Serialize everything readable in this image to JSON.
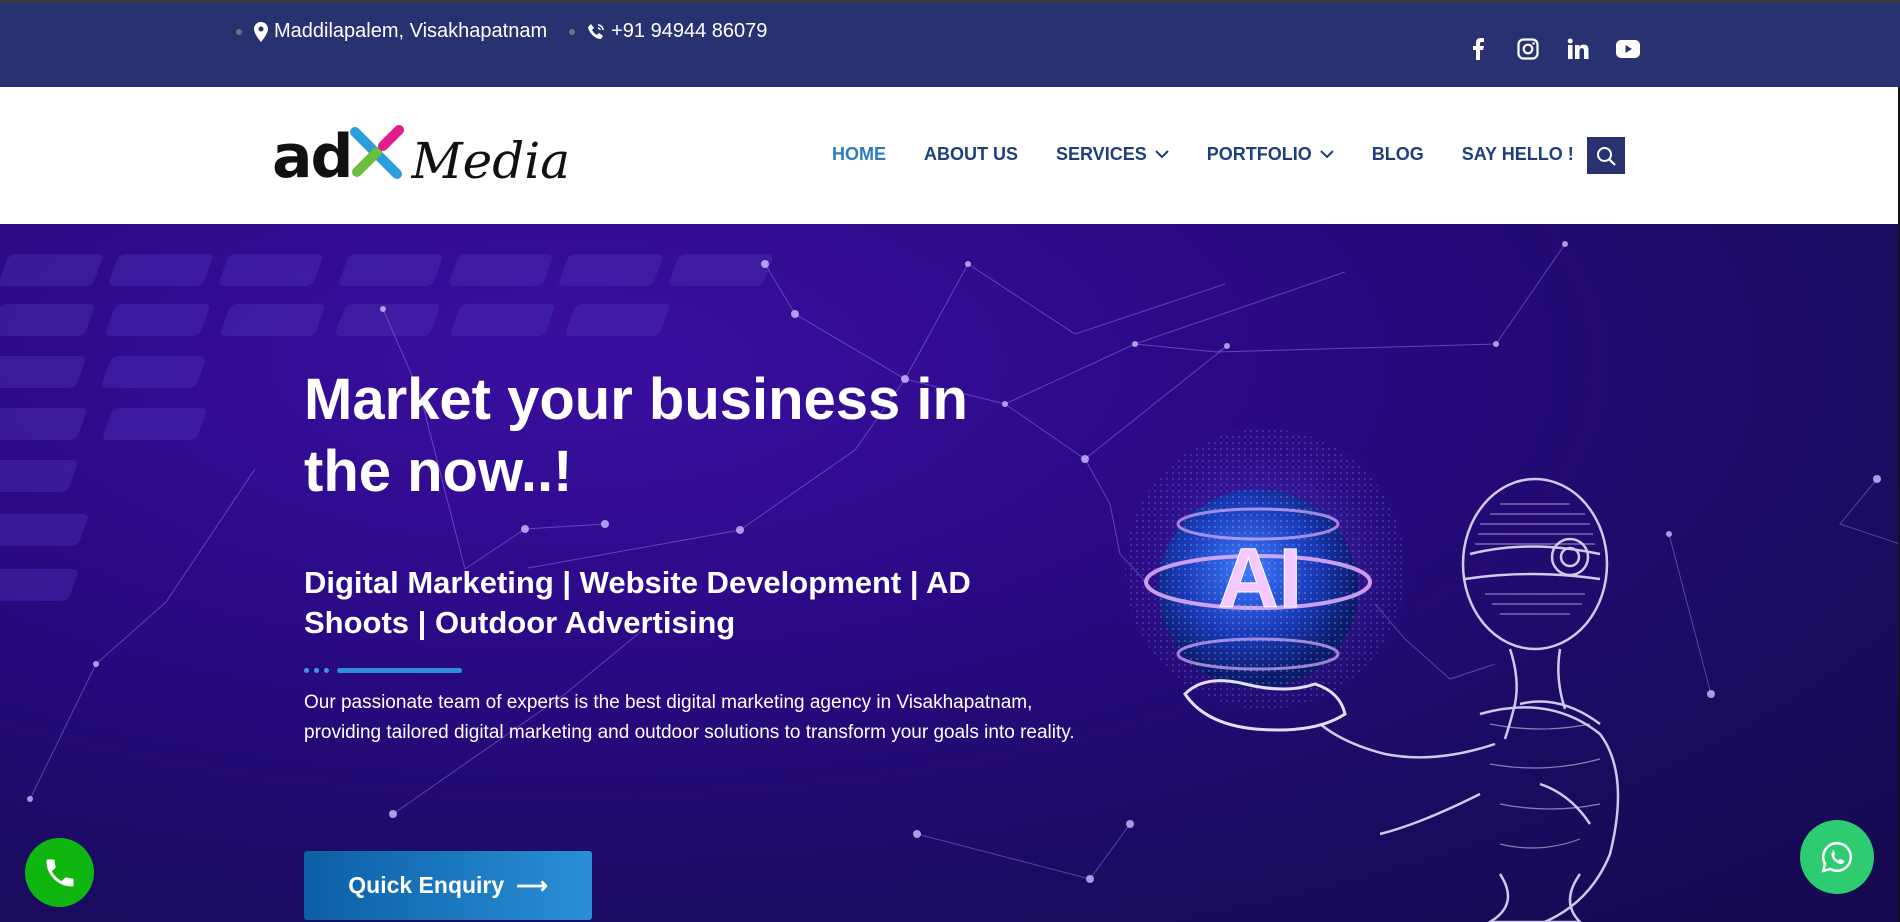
{
  "topbar": {
    "location": "Maddilapalem, Visakhapatnam",
    "phone": "+91 94944 86079",
    "socials": [
      "facebook-icon",
      "instagram-icon",
      "linkedin-icon",
      "youtube-icon"
    ]
  },
  "logo": {
    "ad": "ad",
    "media": "Media"
  },
  "nav": {
    "home": "HOME",
    "about": "ABOUT US",
    "services": "SERVICES",
    "portfolio": "PORTFOLIO",
    "blog": "BLOG",
    "hello": "SAY HELLO !"
  },
  "hero": {
    "title": "Market your business in the now..!",
    "subtitle": "Digital Marketing | Website Development | AD Shoots | Outdoor Advertising",
    "description": "Our passionate team of experts is the best digital marketing agency in Visakhapatnam, providing tailored digital marketing and outdoor solutions to transform your goals into reality.",
    "cta": "Quick Enquiry",
    "cta_arrow": "⟶",
    "ai_text": "AI"
  },
  "colors": {
    "topbar": "#283270",
    "nav_text": "#1d3f7a",
    "nav_active": "#2c7bbf",
    "cta": "#1a78c4",
    "call": "#0fb60f",
    "whatsapp": "#2ecc71"
  }
}
